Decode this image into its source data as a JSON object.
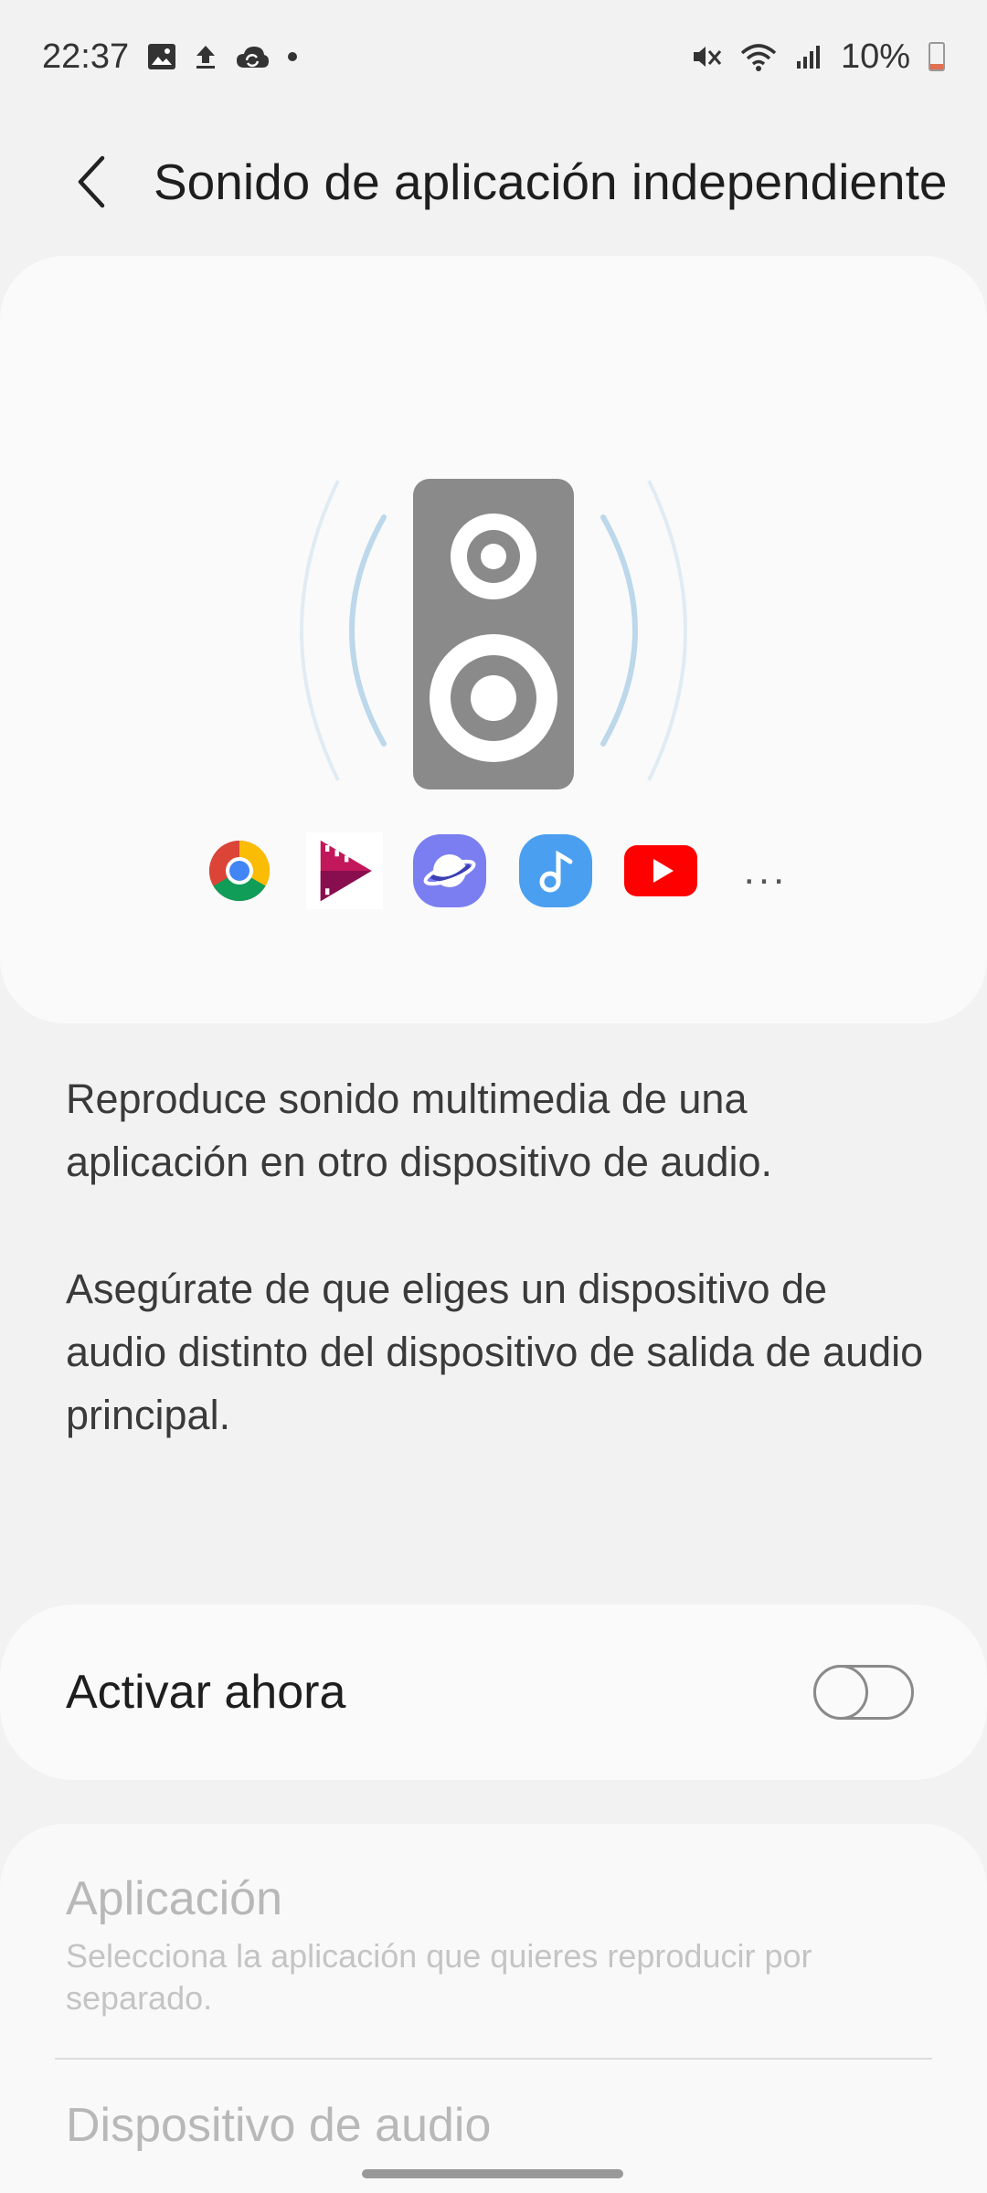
{
  "status_bar": {
    "time": "22:37",
    "left_icons": [
      "image-icon",
      "upload-icon",
      "cloud-sync-icon",
      "dot-icon"
    ],
    "right_icons": [
      "mute-vibrate-icon",
      "wifi-icon",
      "signal-icon",
      "battery-icon"
    ],
    "battery": "10%",
    "battery_color": "#e07050"
  },
  "header": {
    "title": "Sonido de aplicación independiente",
    "back_icon": "back-arrow-icon"
  },
  "illustration": {
    "speaker_color": "#8a8a8a",
    "wave_color": "#bcd8ea",
    "apps": [
      "chrome-icon",
      "google-play-movies-icon",
      "samsung-internet-icon",
      "samsung-music-icon",
      "youtube-icon"
    ],
    "more": "..."
  },
  "description": {
    "paragraph_1": "Reproduce sonido multimedia de una aplicación en otro dispositivo de audio.",
    "paragraph_2": "Asegúrate de que eliges un dispositivo de audio distinto del dispositivo de salida de audio principal."
  },
  "toggle": {
    "label": "Activar ahora",
    "state": "off"
  },
  "options": [
    {
      "title": "Aplicación",
      "subtitle": "Selecciona la aplicación que quieres reproducir por separado."
    },
    {
      "title": "Dispositivo de audio"
    }
  ]
}
